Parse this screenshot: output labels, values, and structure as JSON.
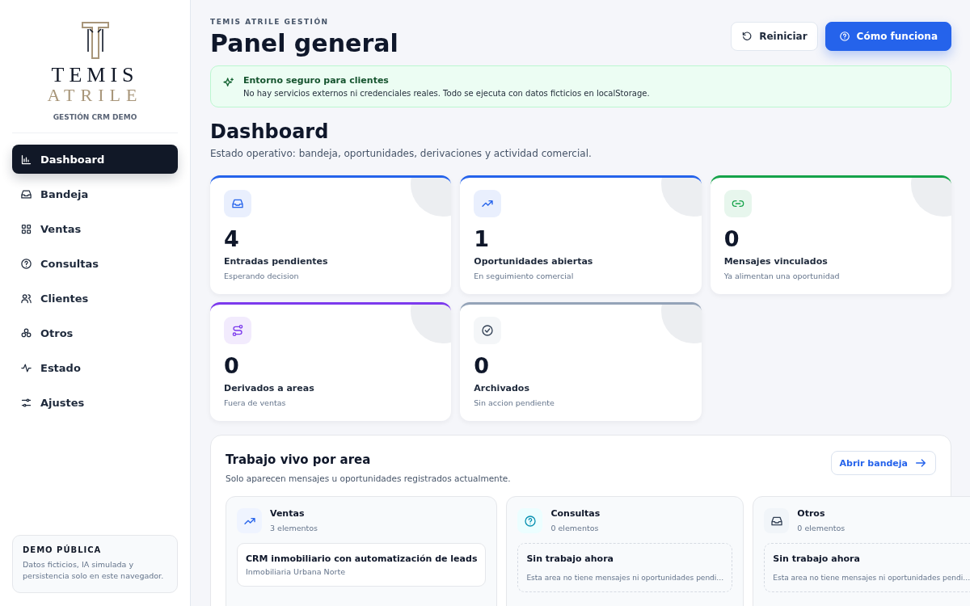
{
  "brand": {
    "line1": "TEMIS",
    "line2": "ATRILE",
    "subtitle": "GESTIÓN CRM DEMO"
  },
  "nav": [
    {
      "label": "Dashboard",
      "kind": "chart",
      "selected": true
    },
    {
      "label": "Bandeja",
      "kind": "inbox",
      "selected": false
    },
    {
      "label": "Ventas",
      "kind": "grid",
      "selected": false
    },
    {
      "label": "Consultas",
      "kind": "help",
      "selected": false
    },
    {
      "label": "Clientes",
      "kind": "users",
      "selected": false
    },
    {
      "label": "Otros",
      "kind": "circles",
      "selected": false
    },
    {
      "label": "Estado",
      "kind": "pulse",
      "selected": false
    },
    {
      "label": "Ajustes",
      "kind": "sliders",
      "selected": false
    }
  ],
  "demo_note": {
    "title": "DEMO PÚBLICA",
    "text": "Datos ficticios, IA simulada y persistencia solo en este navegador."
  },
  "header": {
    "eyebrow": "TEMIS ATRILE GESTIÓN",
    "title": "Panel general",
    "buttons": [
      {
        "label": "Reiniciar",
        "kind": "secondary"
      },
      {
        "label": "Cómo funciona",
        "kind": "primary"
      }
    ]
  },
  "notice": {
    "title": "Entorno seguro para clientes",
    "text": "No hay servicios externos ni credenciales reales. Todo se ejecuta con datos ficticios en localStorage."
  },
  "section": {
    "title": "Dashboard",
    "subtitle": "Estado operativo: bandeja, oportunidades, derivaciones y actividad comercial."
  },
  "stats": [
    {
      "value": "4",
      "label": "Entradas pendientes",
      "hint": "Esperando decision",
      "kind": "inbox",
      "color": "#2563eb"
    },
    {
      "value": "1",
      "label": "Oportunidades abiertas",
      "hint": "En seguimiento comercial",
      "kind": "trend",
      "color": "#2563eb"
    },
    {
      "value": "0",
      "label": "Mensajes vinculados",
      "hint": "Ya alimentan una oportunidad",
      "kind": "link",
      "color": "#16a34a"
    },
    {
      "value": "0",
      "label": "Derivados a areas",
      "hint": "Fuera de ventas",
      "kind": "route",
      "color": "#7c3aed"
    },
    {
      "value": "0",
      "label": "Archivados",
      "hint": "Sin accion pendiente",
      "kind": "check",
      "color": "#94a3b8"
    }
  ],
  "live": {
    "title": "Trabajo vivo por area",
    "subtitle": "Solo aparecen mensajes u oportunidades registrados actualmente.",
    "button": "Abrir bandeja",
    "areas": [
      {
        "name": "Ventas",
        "count": "3 elementos",
        "kind": "trend",
        "items": [
          {
            "title": "CRM inmobiliario con automatización de leads",
            "client": "Inmobiliaria Urbana Norte"
          }
        ]
      },
      {
        "name": "Consultas",
        "count": "0 elementos",
        "kind": "help",
        "empty": {
          "title": "Sin trabajo ahora",
          "text": "Esta area no tiene mensajes ni oportunidades pendi…"
        }
      },
      {
        "name": "Otros",
        "count": "0 elementos",
        "kind": "inbox",
        "empty": {
          "title": "Sin trabajo ahora",
          "text": "Esta area no tiene mensajes ni oportunidades pendi…"
        }
      }
    ]
  }
}
